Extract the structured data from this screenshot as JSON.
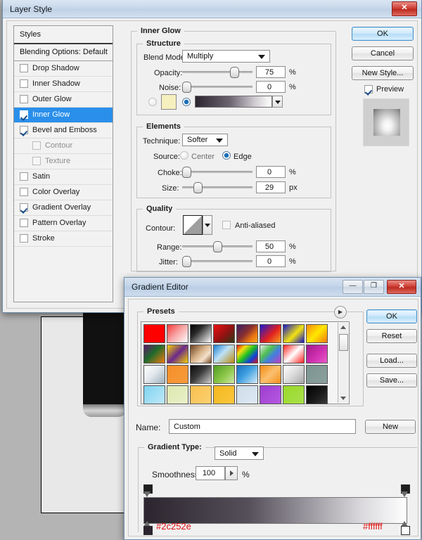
{
  "backdrop": {
    "canvas_color": "#b4b4b4",
    "document_color": "#e8e8e8",
    "object_color": "#111111"
  },
  "layer_style_window": {
    "title": "Layer Style",
    "close_glyph": "✕",
    "styles_panel": {
      "header": "Styles",
      "blending_options": "Blending Options: Default",
      "items": [
        {
          "label": "Drop Shadow",
          "checked": false,
          "selected": false,
          "indent": 0,
          "dim": false
        },
        {
          "label": "Inner Shadow",
          "checked": false,
          "selected": false,
          "indent": 0,
          "dim": false
        },
        {
          "label": "Outer Glow",
          "checked": false,
          "selected": false,
          "indent": 0,
          "dim": false
        },
        {
          "label": "Inner Glow",
          "checked": true,
          "selected": true,
          "indent": 0,
          "dim": false
        },
        {
          "label": "Bevel and Emboss",
          "checked": true,
          "selected": false,
          "indent": 0,
          "dim": false
        },
        {
          "label": "Contour",
          "checked": false,
          "selected": false,
          "indent": 1,
          "dim": true
        },
        {
          "label": "Texture",
          "checked": false,
          "selected": false,
          "indent": 1,
          "dim": true
        },
        {
          "label": "Satin",
          "checked": false,
          "selected": false,
          "indent": 0,
          "dim": false
        },
        {
          "label": "Color Overlay",
          "checked": false,
          "selected": false,
          "indent": 0,
          "dim": false
        },
        {
          "label": "Gradient Overlay",
          "checked": true,
          "selected": false,
          "indent": 0,
          "dim": false
        },
        {
          "label": "Pattern Overlay",
          "checked": false,
          "selected": false,
          "indent": 0,
          "dim": false
        },
        {
          "label": "Stroke",
          "checked": false,
          "selected": false,
          "indent": 0,
          "dim": false
        }
      ]
    },
    "section_title": "Inner Glow",
    "structure": {
      "legend": "Structure",
      "blend_mode_label": "Blend Mode:",
      "blend_mode_value": "Multiply",
      "opacity_label": "Opacity:",
      "opacity_value": "75",
      "opacity_unit": "%",
      "noise_label": "Noise:",
      "noise_value": "0",
      "noise_unit": "%",
      "color_swatch": "#f6f0bf",
      "fill_mode": "gradient",
      "gradient_from": "#2c252e",
      "gradient_to": "#ffffff"
    },
    "elements": {
      "legend": "Elements",
      "technique_label": "Technique:",
      "technique_value": "Softer",
      "source_label": "Source:",
      "source_center_label": "Center",
      "source_edge_label": "Edge",
      "source_selected": "Edge",
      "choke_label": "Choke:",
      "choke_value": "0",
      "choke_unit": "%",
      "size_label": "Size:",
      "size_value": "29",
      "size_unit": "px"
    },
    "quality": {
      "legend": "Quality",
      "contour_label": "Contour:",
      "anti_aliased_label": "Anti-aliased",
      "anti_aliased_checked": false,
      "range_label": "Range:",
      "range_value": "50",
      "range_unit": "%",
      "jitter_label": "Jitter:",
      "jitter_value": "0",
      "jitter_unit": "%"
    },
    "buttons": {
      "ok": "OK",
      "cancel": "Cancel",
      "new_style": "New Style...",
      "preview_label": "Preview",
      "preview_checked": true
    }
  },
  "gradient_editor_window": {
    "title": "Gradient Editor",
    "minimize_glyph": "—",
    "maximize_glyph": "❐",
    "close_glyph": "✕",
    "presets_legend": "Presets",
    "presets_menu_glyph": "▶",
    "preset_swatches": [
      "linear-gradient(90deg,#ff0000,#ff0000)",
      "linear-gradient(135deg,#f43a3a 0%,#f8a0a0 45%,#ffffff 100%)",
      "linear-gradient(135deg,#000000 0%,#2a2a2a 35%,#ffffff 100%)",
      "linear-gradient(135deg,#f01010 0%,#8f1212 55%,#2f3a18 100%)",
      "linear-gradient(135deg,#3a1e66 0%,#8a2f2f 45%,#f07a10 75%,#f5a623 100%)",
      "linear-gradient(135deg,#1a1ad0 0%,#e02020 55%,#f5a020 100%)",
      "linear-gradient(135deg,#1414c8 0%,#f2e310 55%,#1414c8 100%)",
      "linear-gradient(135deg,#f58a10 0%,#ffe800 50%,#f07a10 100%)",
      "linear-gradient(135deg,#5c1a6b 0%,#1f6b2a 45%,#f07a10 100%)",
      "linear-gradient(135deg,#f5d000 0%,#6a2a8a 50%,#f5d000 100%)",
      "linear-gradient(135deg,#6b4020 0%,#d8b48a 45%,#f3e0cc 70%,#7a4a22 100%)",
      "linear-gradient(135deg,#1a7fd4 0%,#bfe2f7 45%,#b98a10 100%)",
      "linear-gradient(135deg,#e01010 0%,#f5e010 25%,#20c020 50%,#1040e0 75%,#e01010 100%)",
      "linear-gradient(135deg,#e8e8e8 0%,#50c050 35%,#4080e0 60%,#c040c0 100%)",
      "linear-gradient(135deg,#ff2020 0%,#ffffff 50%,#ff2020 100%)",
      "linear-gradient(135deg,#a01a8a 0%,#d030b0 55%,#e85ac8 100%)",
      "linear-gradient(135deg,#ffffff 0%,#e4e9ee 45%,#9fb0bd 100%)",
      "linear-gradient(135deg,#f5902a 0%,#f79a3c 100%)",
      "linear-gradient(135deg,#0a0a0a 0%,#3a3a3a 45%,#cfcfcf 100%)",
      "linear-gradient(135deg,#4f9a24 0%,#8ec84a 55%,#cfe8a8 100%)",
      "linear-gradient(135deg,#1a6fc0 0%,#3fa0e0 45%,#d8ecfa 100%)",
      "linear-gradient(135deg,#f58a10 0%,#fbc070 50%,#f5901a 100%)",
      "linear-gradient(135deg,#ffffff 0%,#dcdcdc 48%,#a8a8a8 100%)",
      "linear-gradient(135deg,#7d9490 0%,#8aa09c 100%)",
      "linear-gradient(135deg,#7fd4f0 0%,#bfe8f8 100%)",
      "linear-gradient(135deg,#dde8b0 0%,#e8f0c8 100%)",
      "linear-gradient(135deg,#f8c050 0%,#fbd070 100%)",
      "linear-gradient(135deg,#f5b820 0%,#f8c63c 100%)",
      "linear-gradient(135deg,#ccdcea 0%,#dfe9f2 100%)",
      "linear-gradient(135deg,#a03cd0 0%,#b45ae0 100%)",
      "linear-gradient(135deg,#9ad82a 0%,#a8e04a 100%)",
      "linear-gradient(135deg,#000000 0%,#1a1a1a 55%,#3a3a3a 100%)"
    ],
    "name_label": "Name:",
    "name_value": "Custom",
    "new_button": "New",
    "gradient_type_label": "Gradient Type:",
    "gradient_type_value": "Solid",
    "smoothness_label": "Smoothness:",
    "smoothness_value": "100",
    "smoothness_unit": "%",
    "gradient_preview_from": "#2c252e",
    "gradient_preview_to": "#ffffff",
    "stop_left_hex": "#2c252e",
    "stop_right_hex": "#ffffff",
    "buttons": {
      "ok": "OK",
      "reset": "Reset",
      "load": "Load...",
      "save": "Save..."
    }
  }
}
